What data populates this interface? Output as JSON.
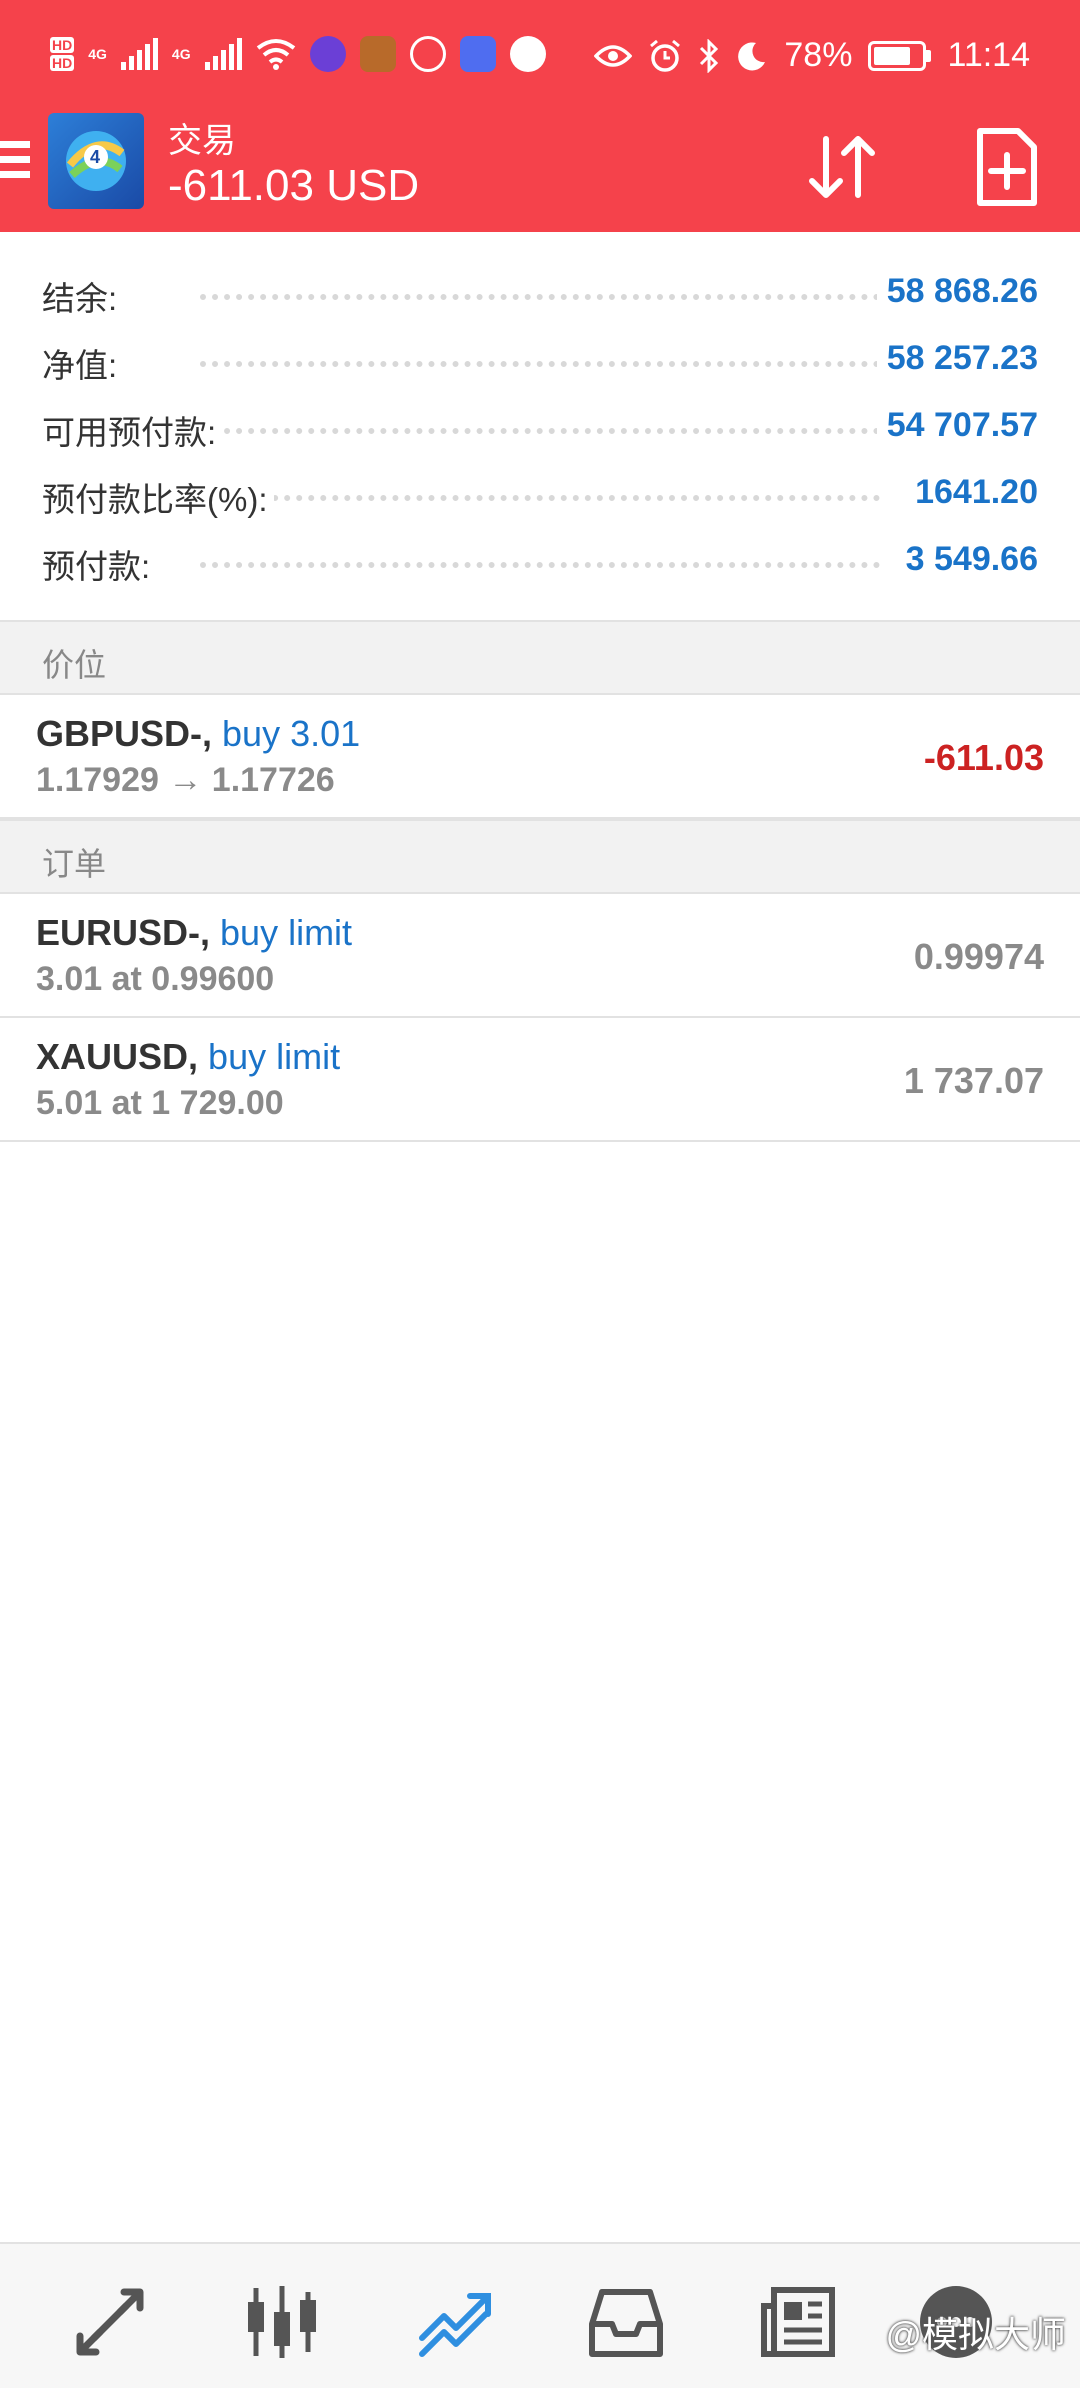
{
  "status_bar": {
    "hd1": "HD",
    "hd2": "HD",
    "net1": "4G",
    "net2": "4G",
    "battery_percent": "78%",
    "battery_level": 0.78,
    "time": "11:14"
  },
  "app_bar": {
    "title": "交易",
    "balance": "-611.03 USD"
  },
  "summary": [
    {
      "label": "结余:",
      "value": "58 868.26"
    },
    {
      "label": "净值:",
      "value": "58 257.23"
    },
    {
      "label": "可用预付款:",
      "value": "54 707.57"
    },
    {
      "label": "预付款比率(%):",
      "value": "1641.20"
    },
    {
      "label": "预付款:",
      "value": "3 549.66"
    }
  ],
  "positions": {
    "header": "价位",
    "items": [
      {
        "symbol": "GBPUSD-,",
        "op": "buy 3.01",
        "detail": "1.17929 → 1.17726",
        "value": "-611.03"
      }
    ]
  },
  "orders": {
    "header": "订单",
    "items": [
      {
        "symbol": "EURUSD-,",
        "op": "buy limit",
        "detail": "3.01 at 0.99600",
        "value": "0.99974"
      },
      {
        "symbol": "XAUUSD,",
        "op": "buy limit",
        "detail": "5.01 at 1 729.00",
        "value": "1 737.07"
      }
    ]
  },
  "colors": {
    "header_red": "#f5424b",
    "accent_blue": "#1a73c8",
    "loss_red": "#cc2222",
    "muted_gray": "#8a8a8a"
  },
  "bottom_nav": {
    "items": [
      "quotes-icon",
      "charts-icon",
      "trade-icon",
      "history-icon",
      "news-icon",
      "chat-icon"
    ],
    "active": "trade-icon"
  },
  "watermark": "@模拟大师"
}
